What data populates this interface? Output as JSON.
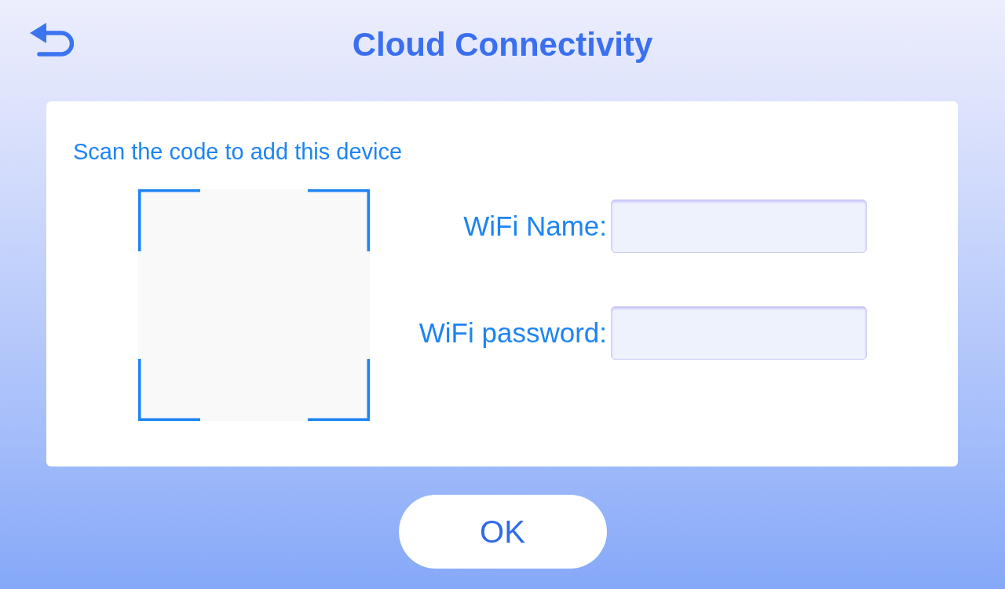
{
  "header": {
    "title": "Cloud Connectivity"
  },
  "card": {
    "instruction": "Scan the code to add this device",
    "fields": [
      {
        "label": "WiFi Name:"
      },
      {
        "label": "WiFi password:"
      }
    ]
  },
  "ok_button": {
    "label": "OK"
  }
}
